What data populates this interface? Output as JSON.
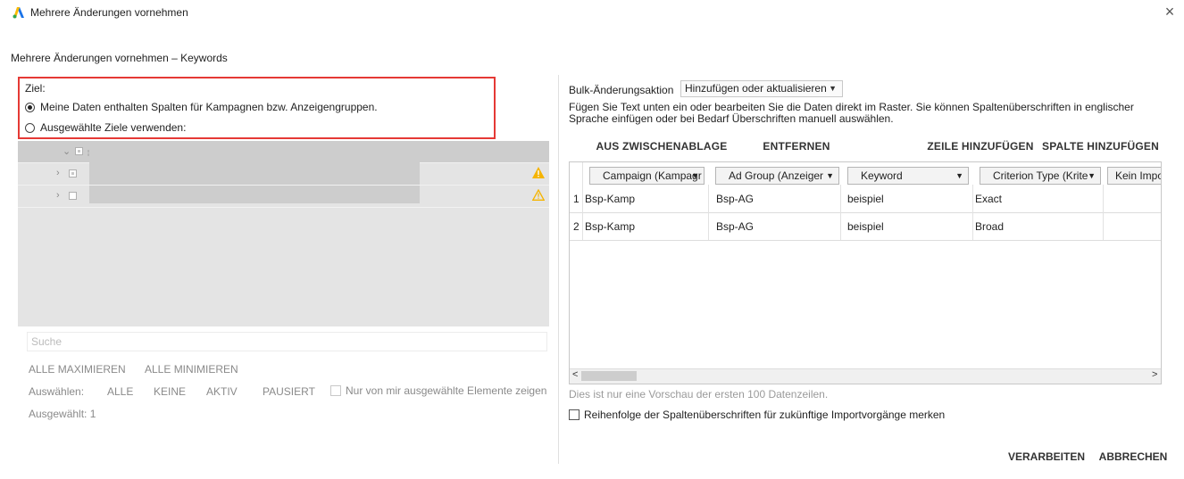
{
  "window": {
    "title": "Mehrere Änderungen vornehmen",
    "close_glyph": "×",
    "logo_icon": "google-ads-logo"
  },
  "dialog": {
    "subtitle": "Mehrere Änderungen vornehmen – Keywords"
  },
  "target": {
    "label": "Ziel:",
    "option_columns": "Meine Daten enthalten Spalten für Kampagnen bzw. Anzeigengruppen.",
    "option_selected_targets": "Ausgewählte Ziele verwenden:",
    "selected_option": "columns"
  },
  "tree": {
    "rows": 3,
    "warning_icons": [
      "warning-filled-icon",
      "warning-outline-icon"
    ]
  },
  "search": {
    "placeholder": "Suche"
  },
  "tree_actions": {
    "expand_all": "ALLE MAXIMIEREN",
    "collapse_all": "ALLE MINIMIEREN",
    "select_label": "Auswählen:",
    "all": "ALLE",
    "none": "KEINE",
    "active": "AKTIV",
    "paused": "PAUSIERT",
    "only_mine": "Nur von mir ausgewählte Elemente zeigen",
    "selected_count": "Ausgewählt: 1"
  },
  "bulk": {
    "label": "Bulk-Änderungsaktion",
    "selected": "Hinzufügen oder aktualisieren",
    "instruction": "Fügen Sie Text unten ein oder bearbeiten Sie die Daten direkt im Raster. Sie können Spaltenüberschriften in englischer Sprache einfügen oder bei Bedarf Überschriften manuell auswählen."
  },
  "toolbar": {
    "paste": "AUS ZWISCHENABLAGE EINFÜGEN",
    "remove": "ENTFERNEN",
    "add_row": "ZEILE HINZUFÜGEN",
    "add_column": "SPALTE HINZUFÜGEN"
  },
  "grid": {
    "headers": [
      "Campaign (Kampagr",
      "Ad Group (Anzeiger",
      "Keyword",
      "Criterion Type (Krite",
      "Kein Impo"
    ],
    "rows": [
      {
        "num": "1",
        "cells": [
          "Bsp-Kamp",
          "Bsp-AG",
          "beispiel",
          "Exact",
          ""
        ]
      },
      {
        "num": "2",
        "cells": [
          "Bsp-Kamp",
          "Bsp-AG",
          "beispiel",
          "Broad",
          ""
        ]
      }
    ],
    "scroll_left": "<",
    "scroll_right": ">"
  },
  "preview_note": "Dies ist nur eine Vorschau der ersten 100 Datenzeilen.",
  "remember_headers": "Reihenfolge der Spaltenüberschriften für zukünftige Importvorgänge merken",
  "footer": {
    "process": "VERARBEITEN",
    "cancel": "ABBRECHEN"
  },
  "colors": {
    "highlight_border": "#e53935",
    "warning": "#f5b400"
  }
}
